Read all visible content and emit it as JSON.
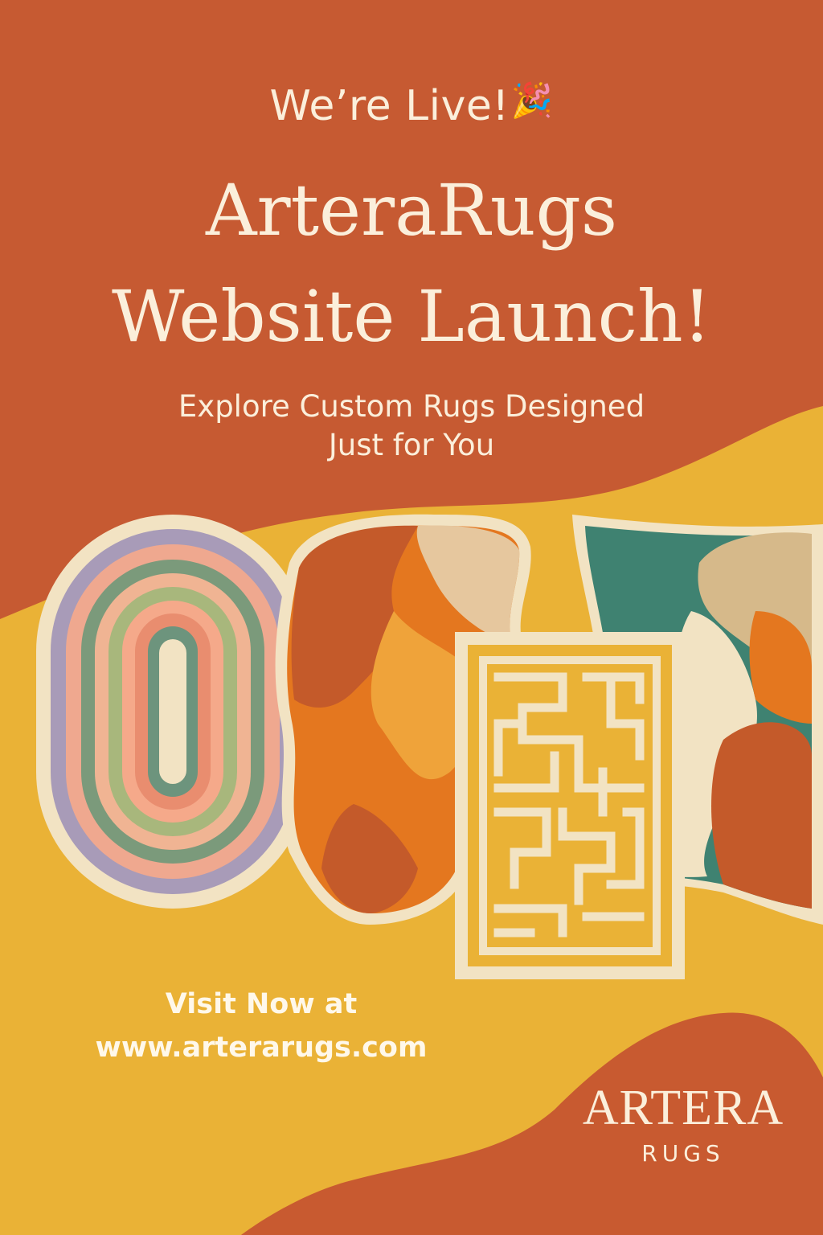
{
  "announcement": {
    "prefix": "We’re Live!",
    "celebration_icon": "party-popper-icon",
    "title_line1": "ArteraRugs",
    "title_line2": "Website Launch!",
    "subtitle_line1": "Explore Custom Rugs Designed",
    "subtitle_line2": "Just for You"
  },
  "call_to_action": {
    "line1": "Visit Now at",
    "line2": "www.arterarugs.com"
  },
  "logo": {
    "wordmark": "ARTERA",
    "subline": "RUGS"
  },
  "colors": {
    "background_rust": "#c65a32",
    "background_mustard": "#eab236",
    "text_cream": "#fbefdb",
    "rug_cream": "#f2e3c3",
    "rug_teal": "#3f8271"
  }
}
